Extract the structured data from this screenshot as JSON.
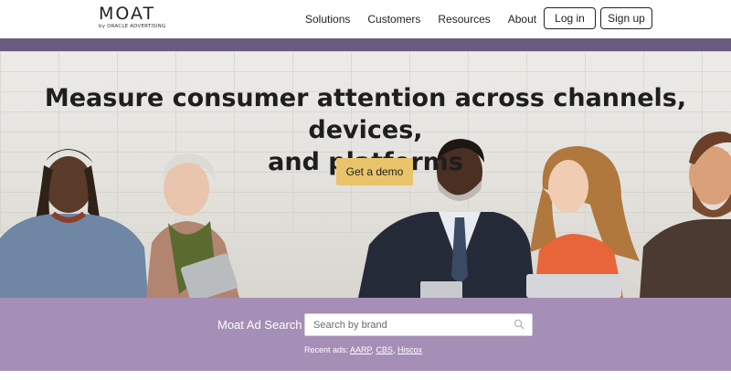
{
  "header": {
    "logo_main": "MOAT",
    "logo_sub": "by ORACLE ADVERTISING",
    "nav": [
      "Solutions",
      "Customers",
      "Resources",
      "About"
    ],
    "login_label": "Log in",
    "signup_label": "Sign up"
  },
  "hero": {
    "title_line1": "Measure consumer attention across channels, devices,",
    "title_line2": "and platforms",
    "cta_label": "Get a demo"
  },
  "search": {
    "label": "Moat Ad Search",
    "placeholder": "Search by brand",
    "recent_prefix": "Recent ads:",
    "recent_items": [
      "AARP",
      "CBS",
      "Hiscox"
    ]
  },
  "colors": {
    "band_purple": "#6b5a80",
    "search_band": "#a58fb6",
    "cta_yellow": "#e9c46a"
  }
}
